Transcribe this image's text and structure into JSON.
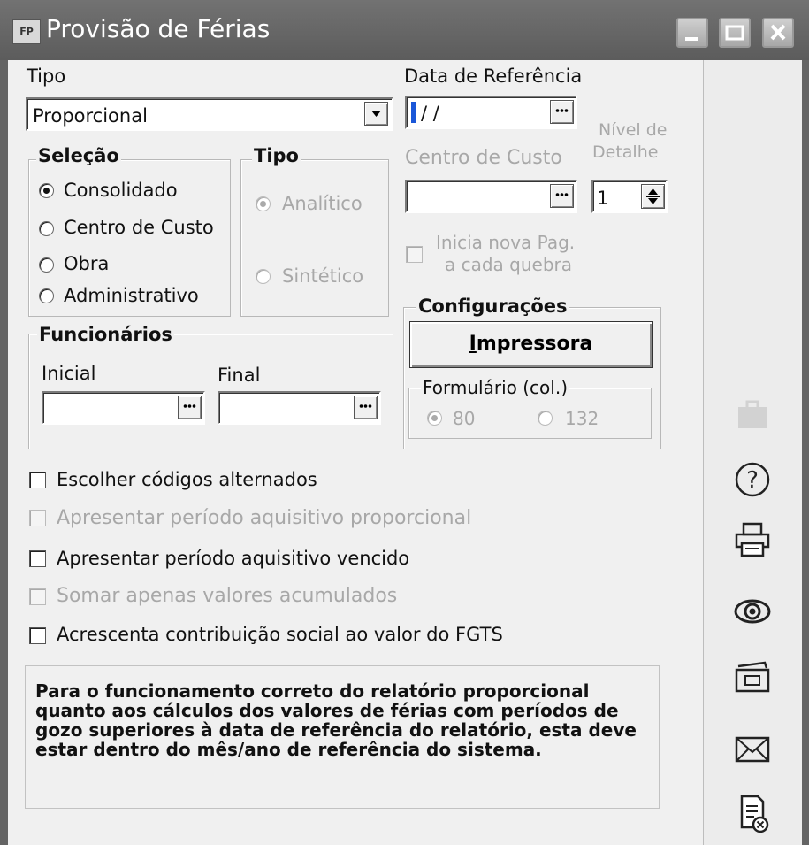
{
  "window": {
    "app_icon": "FP",
    "title": "Provisão de Férias",
    "controls": [
      "minimize-icon",
      "maximize-icon",
      "close-icon"
    ]
  },
  "tipo": {
    "label": "Tipo",
    "value": "Proporcional"
  },
  "data_referencia": {
    "label": "Data de Referência",
    "value": "/ /"
  },
  "centro_custo": {
    "label": "Centro de Custo",
    "value": ""
  },
  "nivel_detalhe": {
    "label_line1": "Nível de",
    "label_line2": "Detalhe",
    "value": "1"
  },
  "selecao": {
    "legend": "Seleção",
    "options": [
      "Consolidado",
      "Centro de Custo",
      "Obra",
      "Administrativo"
    ],
    "selected": "Consolidado"
  },
  "tipo_group": {
    "legend": "Tipo",
    "options": [
      "Analítico",
      "Sintético"
    ],
    "selected": "Analítico",
    "enabled": false
  },
  "inicia_nova_pag": {
    "line1": "Inicia nova Pag.",
    "line2": "a cada quebra",
    "checked": false,
    "enabled": false
  },
  "configuracoes": {
    "legend": "Configurações",
    "printer_button_prefix": "I",
    "printer_button_rest": "mpressora",
    "formulario": {
      "legend": "Formulário (col.)",
      "options": [
        "80",
        "132"
      ],
      "selected": "80",
      "enabled": false
    }
  },
  "funcionarios": {
    "legend": "Funcionários",
    "inicial_label": "Inicial",
    "final_label": "Final",
    "inicial_value": "",
    "final_value": ""
  },
  "checkboxes": [
    {
      "label": "Escolher códigos alternados",
      "checked": false,
      "enabled": true
    },
    {
      "label": "Apresentar período aquisitivo proporcional",
      "checked": false,
      "enabled": false
    },
    {
      "label": "Apresentar período aquisitivo vencido",
      "checked": false,
      "enabled": true
    },
    {
      "label": "Somar apenas valores acumulados",
      "checked": false,
      "enabled": false
    },
    {
      "label": "Acrescenta contribuição social ao valor do FGTS",
      "checked": false,
      "enabled": true
    }
  ],
  "note": "Para o funcionamento correto do relatório proporcional quanto aos cálculos dos valores de férias com períodos de gozo superiores à data de referência do relatório, esta deve estar dentro do mês/ano de referência do sistema.",
  "sidebar_icons": [
    "briefcase-icon",
    "help-icon",
    "printer-icon",
    "preview-eye-icon",
    "export-folder-icon",
    "email-icon",
    "cancel-report-icon"
  ],
  "colors": {
    "title_bar": "#646464",
    "disabled_text": "#a8a8a8",
    "window_bg": "#f0f0f0"
  }
}
